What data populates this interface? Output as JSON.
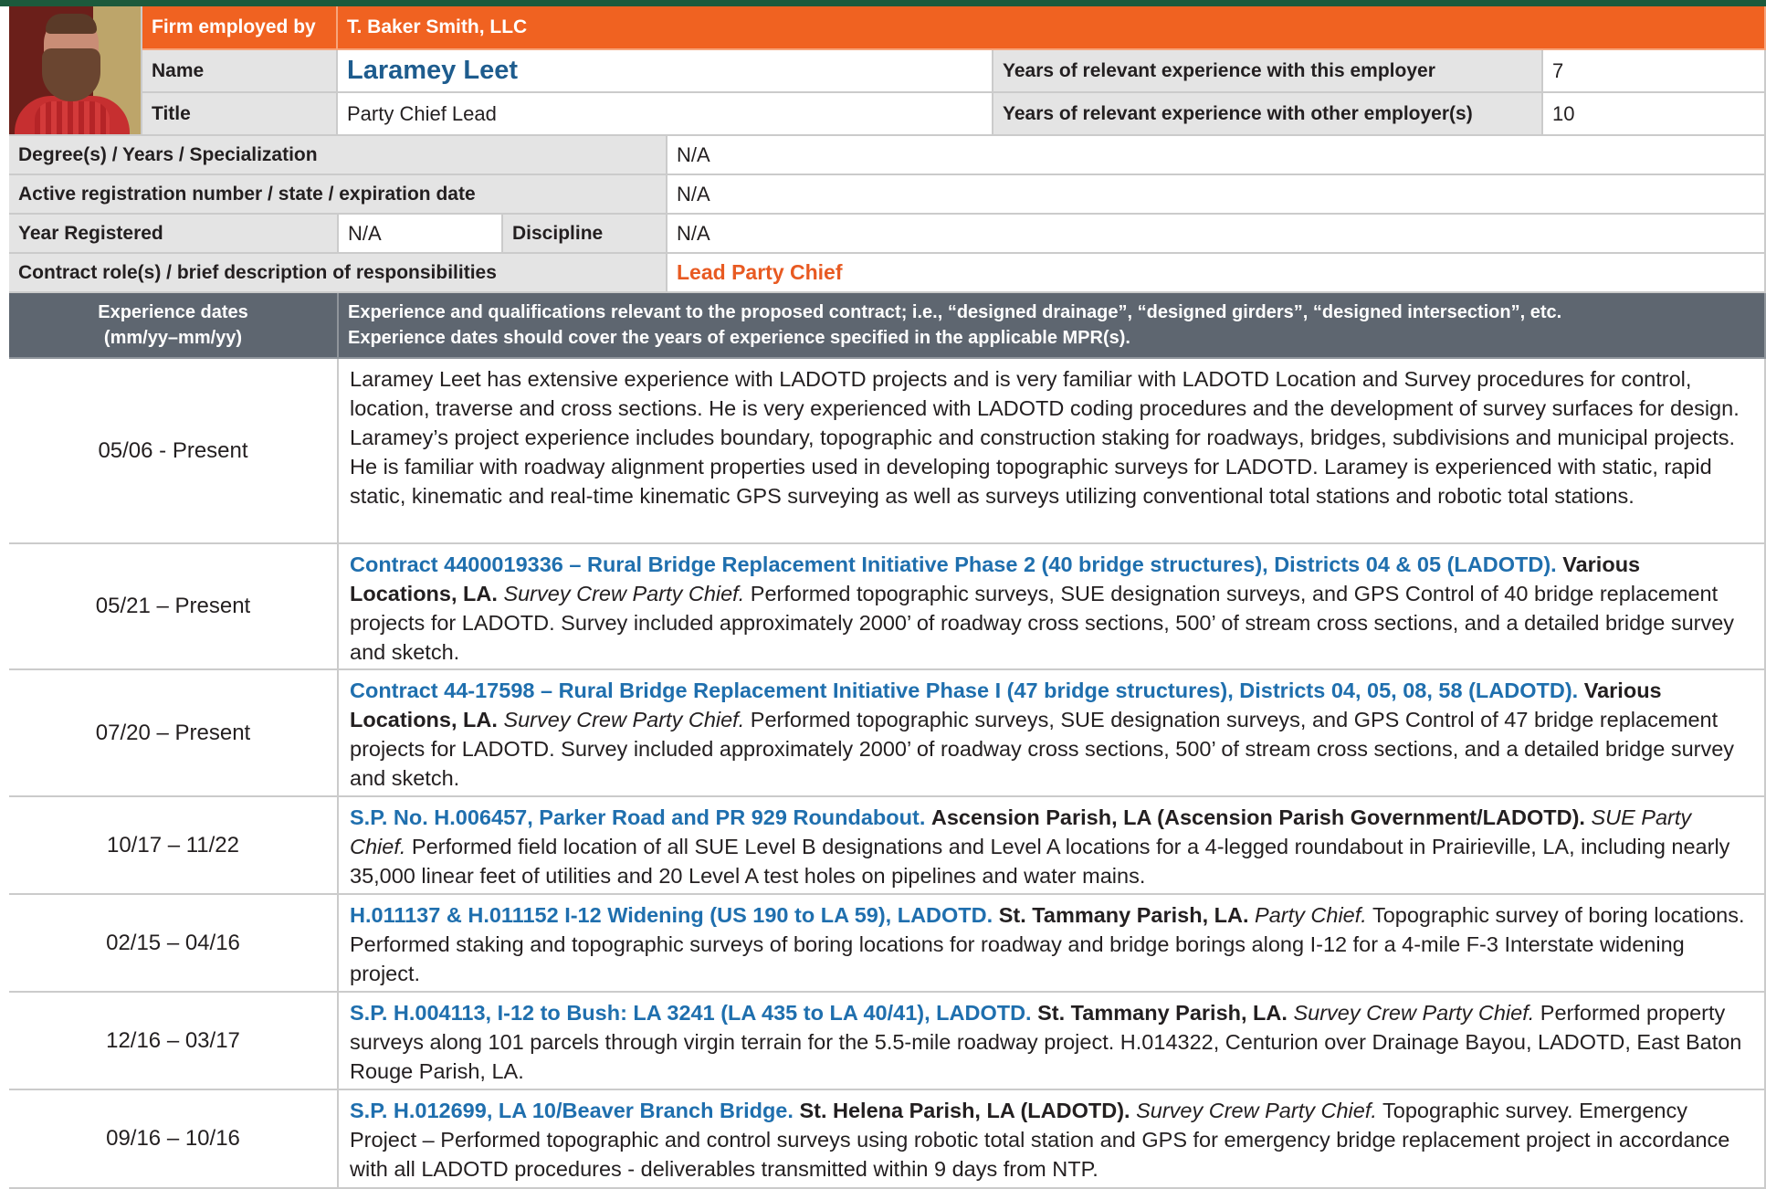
{
  "header": {
    "firm_label": "Firm employed by",
    "firm_value": "T. Baker Smith, LLC",
    "name_label": "Name",
    "name_value": "Laramey Leet",
    "title_label": "Title",
    "title_value": "Party Chief Lead",
    "years_employer_label": "Years of relevant experience with this employer",
    "years_employer_value": "7",
    "years_other_label": "Years of relevant experience with other employer(s)",
    "years_other_value": "10"
  },
  "info": {
    "degree_label": "Degree(s) / Years / Specialization",
    "degree_value": "N/A",
    "registration_label": "Active registration number / state / expiration date",
    "registration_value": "N/A",
    "year_registered_label": "Year Registered",
    "year_registered_value": "N/A",
    "discipline_label": "Discipline",
    "discipline_value": "N/A",
    "role_label": "Contract role(s) / brief description of responsibilities",
    "role_value": "Lead Party Chief"
  },
  "experience_header": {
    "dates_line1": "Experience dates",
    "dates_line2": "(mm/yy–mm/yy)",
    "desc_line1": "Experience and qualifications relevant to the proposed contract; i.e., “designed drainage”, “designed girders”, “designed intersection”, etc.",
    "desc_line2": "Experience dates should cover the years of experience specified in the applicable MPR(s)."
  },
  "experience": [
    {
      "dates": "05/06 - Present",
      "project": "",
      "location": "",
      "role": "",
      "text": "Laramey Leet has extensive experience with LADOTD projects and is very familiar with LADOTD Location and Survey procedures for control, location, traverse and cross sections. He is very experienced with LADOTD coding procedures and the development of survey surfaces for design. Laramey’s project experience includes boundary, topographic and construction staking for roadways, bridges, subdivisions and municipal projects. He is familiar with roadway alignment properties used in developing topographic surveys for LADOTD. Laramey is experienced with static, rapid static, kinematic and real-time kinematic GPS surveying as well as surveys utilizing conventional total stations and robotic total stations."
    },
    {
      "dates": "05/21 – Present",
      "project": "Contract 4400019336 – Rural Bridge Replacement Initiative Phase 2 (40 bridge structures), Districts 04 & 05 (LADOTD).",
      "location": "Various Locations, LA.",
      "role": "Survey Crew Party Chief.",
      "text": "Performed topographic surveys, SUE designation surveys, and GPS Control of 40 bridge replacement projects for LADOTD. Survey included approximately 2000’ of roadway cross sections, 500’ of stream cross sections, and a detailed bridge survey and sketch."
    },
    {
      "dates": "07/20 – Present",
      "project": "Contract 44-17598 – Rural Bridge Replacement Initiative Phase I (47 bridge structures), Districts 04, 05, 08, 58 (LADOTD).",
      "location": "Various Locations, LA.",
      "role": "Survey Crew Party Chief.",
      "text": "Performed topographic surveys, SUE designation surveys, and GPS Control of 47 bridge replacement projects for LADOTD. Survey included approximately 2000’ of roadway cross sections, 500’ of stream cross sections, and a detailed bridge survey and sketch."
    },
    {
      "dates": "10/17 – 11/22",
      "project": "S.P. No. H.006457, Parker Road and PR 929 Roundabout.",
      "location": "Ascension Parish, LA (Ascension Parish Government/LADOTD).",
      "role": "SUE Party Chief.",
      "text": "Performed field location of all SUE Level B designations and Level A locations for a 4-legged roundabout in Prairieville, LA, including nearly 35,000 linear feet of utilities and 20 Level A test holes on pipelines and water mains."
    },
    {
      "dates": "02/15 – 04/16",
      "project": "H.011137 & H.011152 I-12 Widening (US 190 to LA 59), LADOTD.",
      "location": "St. Tammany Parish, LA.",
      "role": "Party Chief.",
      "text": "Topographic survey of boring locations. Performed staking and topographic surveys of boring locations for roadway and bridge borings along I-12 for a 4-mile F-3 Interstate widening project."
    },
    {
      "dates": "12/16 – 03/17",
      "project": "S.P. H.004113, I-12 to Bush: LA 3241 (LA 435 to LA 40/41), LADOTD.",
      "location": "St. Tammany Parish, LA.",
      "role": "Survey Crew Party Chief.",
      "text": "Performed property surveys along 101 parcels through virgin terrain for the 5.5-mile roadway project. H.014322, Centurion over Drainage Bayou, LADOTD, East Baton Rouge Parish, LA."
    },
    {
      "dates": "09/16 – 10/16",
      "project": "S.P. H.012699, LA 10/Beaver Branch Bridge.",
      "location": "St. Helena Parish, LA (LADOTD).",
      "role": "Survey Crew Party Chief.",
      "text": "Topographic survey. Emergency Project – Performed topographic and control surveys using robotic total station and GPS for emergency bridge replacement project in accordance with all LADOTD procedures - deliverables transmitted within 9 days from NTP."
    }
  ]
}
